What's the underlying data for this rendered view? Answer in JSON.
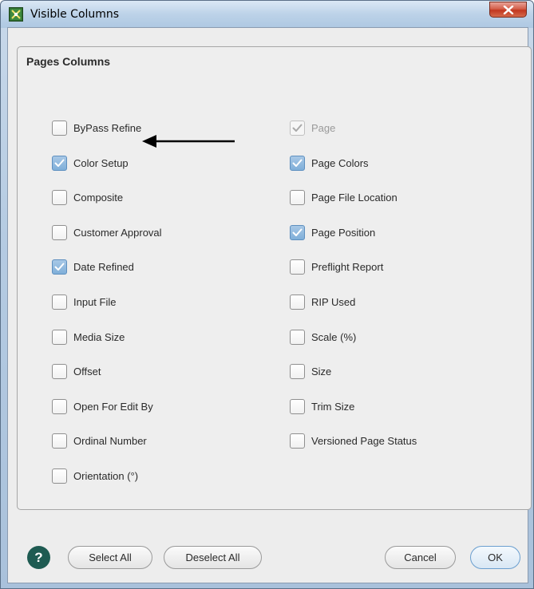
{
  "window": {
    "title": "Visible Columns",
    "close_symbol": "X"
  },
  "group": {
    "title": "Pages Columns"
  },
  "left_column": [
    {
      "label": "ByPass Refine",
      "checked": false
    },
    {
      "label": "Color Setup",
      "checked": true
    },
    {
      "label": "Composite",
      "checked": false
    },
    {
      "label": "Customer Approval",
      "checked": false
    },
    {
      "label": "Date Refined",
      "checked": true
    },
    {
      "label": "Input File",
      "checked": false
    },
    {
      "label": "Media Size",
      "checked": false
    },
    {
      "label": "Offset",
      "checked": false
    },
    {
      "label": "Open For Edit By",
      "checked": false
    },
    {
      "label": "Ordinal Number",
      "checked": false
    },
    {
      "label": "Orientation (°)",
      "checked": false
    }
  ],
  "right_column": [
    {
      "label": "Page",
      "checked": true,
      "disabled": true
    },
    {
      "label": "Page Colors",
      "checked": true
    },
    {
      "label": "Page File Location",
      "checked": false
    },
    {
      "label": "Page Position",
      "checked": true
    },
    {
      "label": "Preflight Report",
      "checked": false
    },
    {
      "label": "RIP Used",
      "checked": false
    },
    {
      "label": "Scale (%)",
      "checked": false
    },
    {
      "label": "Size",
      "checked": false
    },
    {
      "label": "Trim Size",
      "checked": false
    },
    {
      "label": "Versioned Page Status",
      "checked": false
    }
  ],
  "buttons": {
    "help": "?",
    "select_all": "Select All",
    "deselect_all": "Deselect All",
    "cancel": "Cancel",
    "ok": "OK"
  },
  "icons": {
    "app": "app-icon",
    "annotation": "arrow-left-icon"
  },
  "colors": {
    "help_button": "#1e5b52",
    "check_accent": "#7fafd9",
    "close_button": "#c2371f"
  }
}
